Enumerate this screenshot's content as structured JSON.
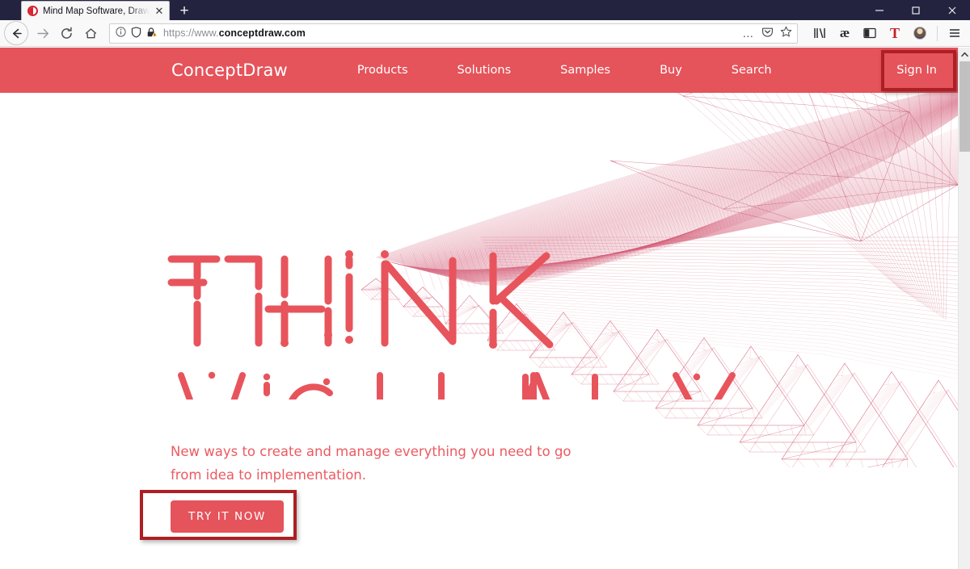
{
  "browser": {
    "tab": {
      "title": "Mind Map Software, Drawing T",
      "close_label": "✕"
    },
    "new_tab_label": "+",
    "window_controls": {
      "minimize": "Minimize",
      "maximize": "Maximize",
      "close": "Close"
    },
    "nav": {
      "back": "Back",
      "forward": "Forward",
      "reload": "Reload",
      "home": "Home"
    },
    "url": {
      "prefix": "https://www.",
      "domain": "conceptdraw.com",
      "page_info_icon": "info-icon",
      "tracking_icon": "shield-icon",
      "lock_icon": "lock-warning-icon",
      "menu_dots": "…",
      "pocket": "pocket-icon",
      "bookmark": "star-icon"
    },
    "toolbar_icons": [
      {
        "name": "library-icon",
        "glyph": "library"
      },
      {
        "name": "ae-extension-icon",
        "glyph": "æ"
      },
      {
        "name": "reader-view-icon",
        "glyph": "reader"
      },
      {
        "name": "text-extension-icon",
        "glyph": "T"
      },
      {
        "name": "account-avatar",
        "glyph": "avatar"
      },
      {
        "name": "app-menu-icon",
        "glyph": "hamburger"
      }
    ]
  },
  "site": {
    "brand": "ConceptDraw",
    "nav_links": [
      {
        "label": "Products"
      },
      {
        "label": "Solutions"
      },
      {
        "label": "Samples"
      },
      {
        "label": "Buy"
      },
      {
        "label": "Search"
      }
    ],
    "sign_in": "Sign In",
    "headline_line1": "THINK",
    "headline_line2": "VISUALLY",
    "tagline": "New ways to create and manage everything you need to go from idea to implementation.",
    "cta": "TRY IT NOW"
  },
  "colors": {
    "brand_red": "#e5535b",
    "tagline_red": "#ec5a61",
    "annotation_red": "#ad1f24",
    "titlebar_navy": "#232340",
    "toolbar_gray": "#f9f9fa"
  },
  "annotations": [
    {
      "name": "sign-in-highlight",
      "target": "Sign In"
    },
    {
      "name": "try-it-now-highlight",
      "target": "TRY IT NOW"
    }
  ],
  "scrollbar": {
    "position": "top",
    "thumb_visible": true
  }
}
